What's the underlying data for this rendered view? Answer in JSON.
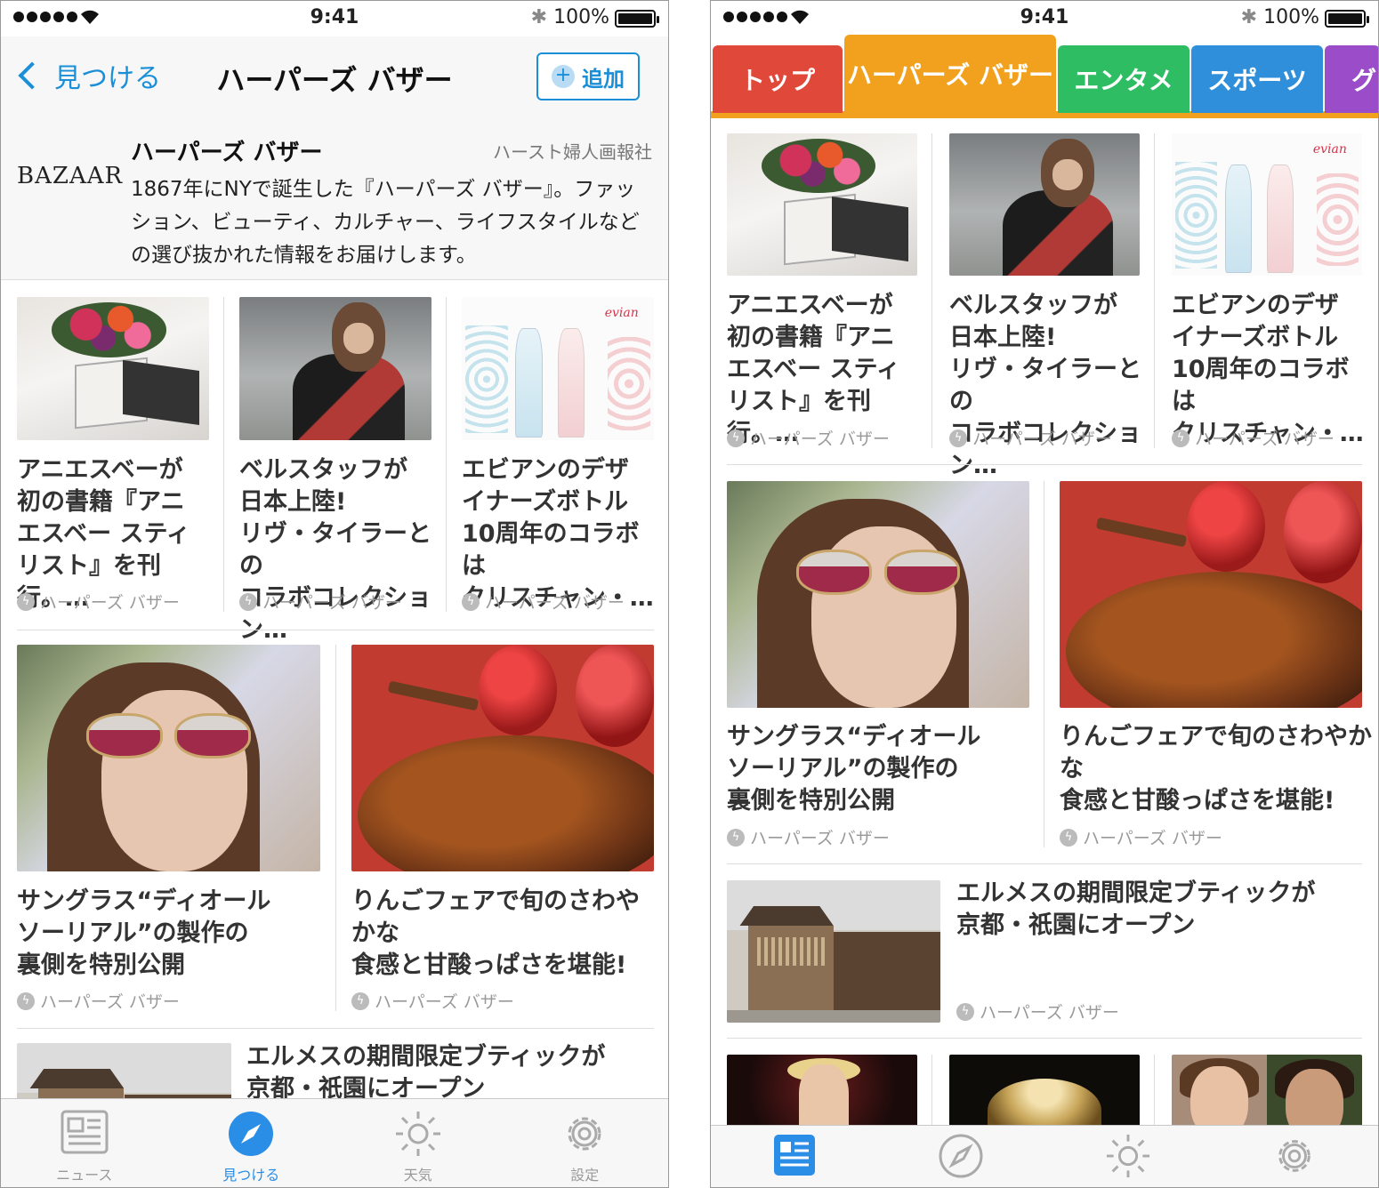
{
  "status": {
    "time": "9:41",
    "battery": "100%"
  },
  "left": {
    "nav": {
      "back_label": "見つける",
      "title": "ハーパーズ バザー",
      "add_label": "追加"
    },
    "source": {
      "logo": "BAZAAR",
      "name": "ハーパーズ バザー",
      "publisher": "ハースト婦人画報社",
      "description": "1867年にNYで誕生した『ハーパーズ バザー』。ファッション、ビューティ、カルチャー、ライフスタイルなどの選び抜かれた情報をお届けします。"
    }
  },
  "articles": {
    "a1": "アニエスベーが\n初の書籍『アニ\nエスベー スティ\nリスト』を刊行。…",
    "a2": "ベルスタッフが\n日本上陸!\nリヴ・タイラーとの\nコラボコレクション…",
    "a3": "エビアンのデザ\nイナーズボトル\n10周年のコラボは\nクリスチャン・…",
    "a4": "サングラス“ディオール\nソーリアル”の製作の\n裏側を特別公開",
    "a5": "りんごフェアで旬のさわやかな\n食感と甘酸っぱさを堪能!",
    "a6": "エルメスの期間限定ブティックが\n京都・祇園にオープン",
    "source_label": "ハーパーズ バザー"
  },
  "evian_brand": "evian",
  "tabbar": {
    "news": "ニュース",
    "discover": "見つける",
    "weather": "天気",
    "settings": "設定"
  },
  "categories": [
    {
      "label": "トップ",
      "color": "#e0483a"
    },
    {
      "label": "ハーパーズ バザー",
      "color": "#f2a11f"
    },
    {
      "label": "エンタメ",
      "color": "#2ebd63"
    },
    {
      "label": "スポーツ",
      "color": "#2f8fdb"
    },
    {
      "label": "グ",
      "color": "#9b4dc9"
    }
  ],
  "colors": {
    "accent": "#1a8fd8",
    "tab_active": "#2b8ee6"
  }
}
